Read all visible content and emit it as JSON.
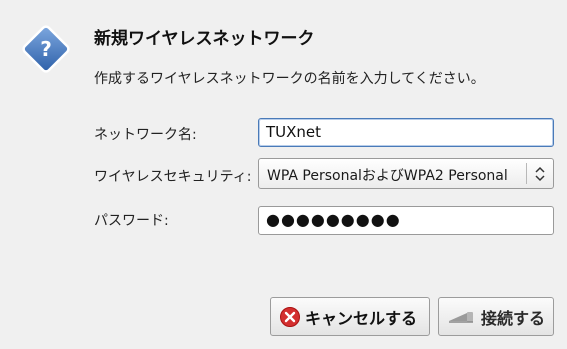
{
  "dialog": {
    "title": "新規ワイヤレスネットワーク",
    "subtitle": "作成するワイヤレスネットワークの名前を入力してください。",
    "icon": "question-diamond-icon"
  },
  "form": {
    "network_name_label": "ネットワーク名:",
    "network_name_value": "TUXnet",
    "security_label": "ワイヤレスセキュリティ:",
    "security_value": "WPA PersonalおよびWPA2 Personal",
    "password_label": "パスワード:",
    "password_mask": "●●●●●●●●●"
  },
  "buttons": {
    "cancel_label": "キャンセルする",
    "connect_label": "接続する"
  },
  "colors": {
    "background": "#f0f0f0",
    "icon_blue": "#3d6fb5",
    "cancel_icon_red": "#d32f2f",
    "focus_border": "#4a7ab8"
  }
}
